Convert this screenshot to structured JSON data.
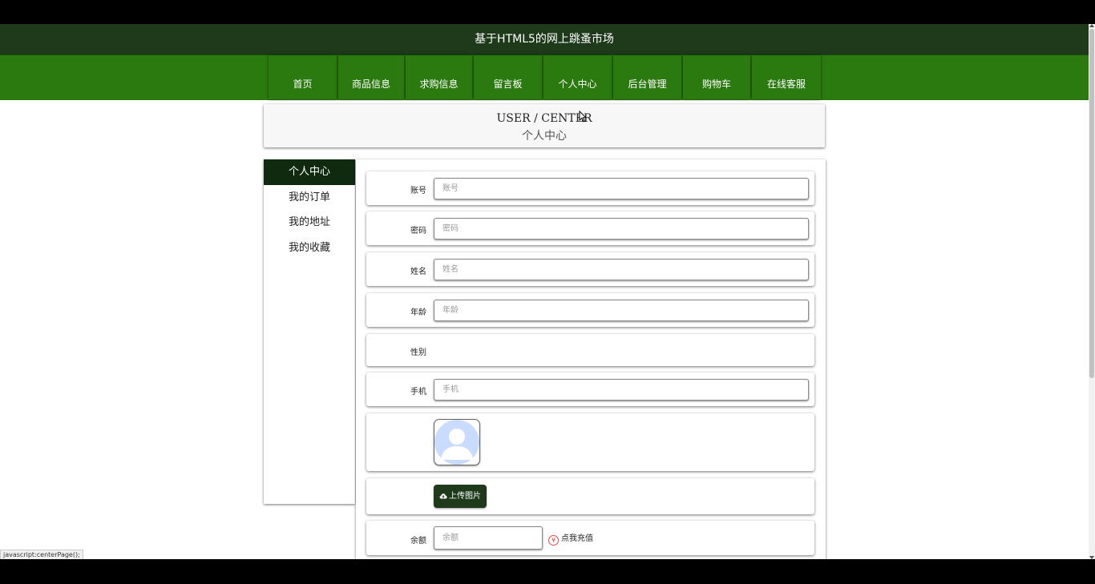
{
  "site_title": "基于HTML5的网上跳蚤市场",
  "nav": [
    "首页",
    "商品信息",
    "求购信息",
    "留言板",
    "个人中心",
    "后台管理",
    "购物车",
    "在线客服"
  ],
  "banner": {
    "en": "USER / CENTER",
    "cn": "个人中心"
  },
  "sidebar": [
    "个人中心",
    "我的订单",
    "我的地址",
    "我的收藏"
  ],
  "form": {
    "account": {
      "label": "账号",
      "placeholder": "账号"
    },
    "password": {
      "label": "密码",
      "placeholder": "密码"
    },
    "name": {
      "label": "姓名",
      "placeholder": "姓名"
    },
    "age": {
      "label": "年龄",
      "placeholder": "年龄"
    },
    "gender": {
      "label": "性别"
    },
    "phone": {
      "label": "手机",
      "placeholder": "手机"
    },
    "upload_label": "上传图片",
    "balance": {
      "label": "余额",
      "placeholder": "余额"
    },
    "recharge_label": "点我充值",
    "recharge_symbol": "¥"
  },
  "status_url": "javascript:centerPage();",
  "colors": {
    "header_bg": "#1e3a1b",
    "nav_bg": "#2b7a10",
    "active_side_bg": "#0f2a0e"
  },
  "icons": [
    "cloud-upload-icon",
    "yen-icon",
    "avatar-placeholder-icon"
  ]
}
